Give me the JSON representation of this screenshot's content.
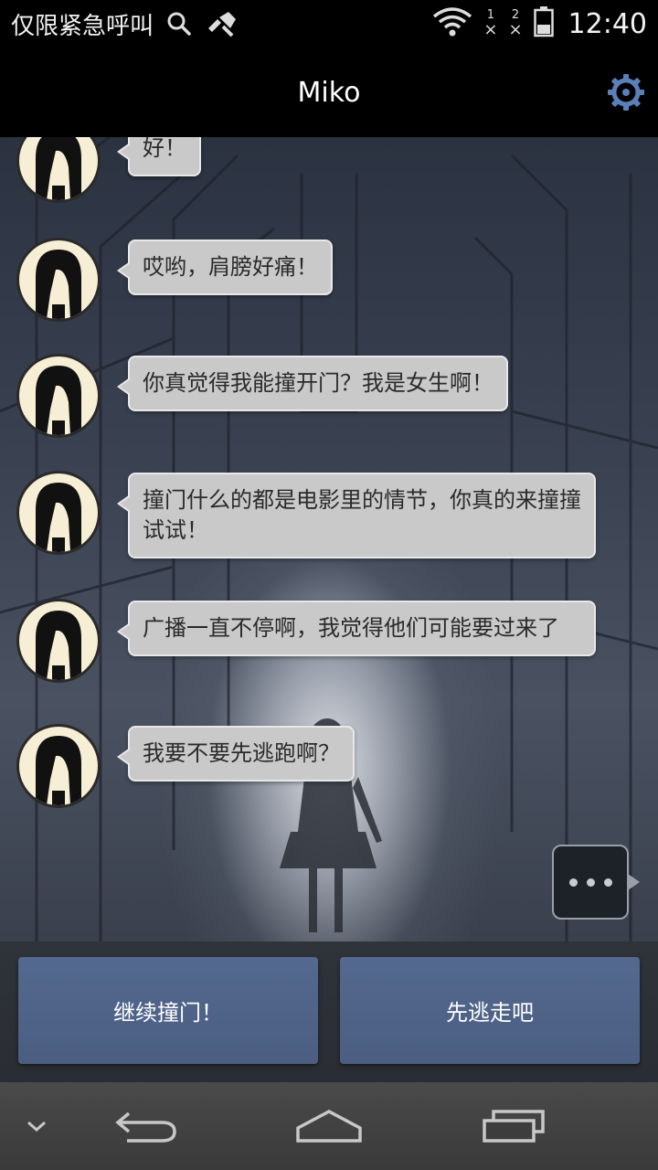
{
  "status_bar": {
    "carrier": "仅限紧急呼叫",
    "sim1": "1",
    "sim2": "2",
    "time": "12:40"
  },
  "app_bar": {
    "title": "Miko",
    "settings_icon": "gear-icon",
    "accent_color": "#5b7fb8"
  },
  "messages": [
    {
      "text": "好！"
    },
    {
      "text": "哎哟，肩膀好痛！"
    },
    {
      "text": "你真觉得我能撞开门？我是女生啊！"
    },
    {
      "text": "撞门什么的都是电影里的情节，你真的来撞撞试试！"
    },
    {
      "text": "广播一直不停啊，我觉得他们可能要过来了"
    },
    {
      "text": "我要不要先逃跑啊？"
    }
  ],
  "typing_indicator": {
    "icon": "ellipsis-icon"
  },
  "choices": [
    {
      "label": "继续撞门！"
    },
    {
      "label": "先逃走吧"
    }
  ],
  "nav_bar": {
    "icons": [
      "chevron-down-icon",
      "back-icon",
      "home-icon",
      "recent-apps-icon"
    ]
  }
}
